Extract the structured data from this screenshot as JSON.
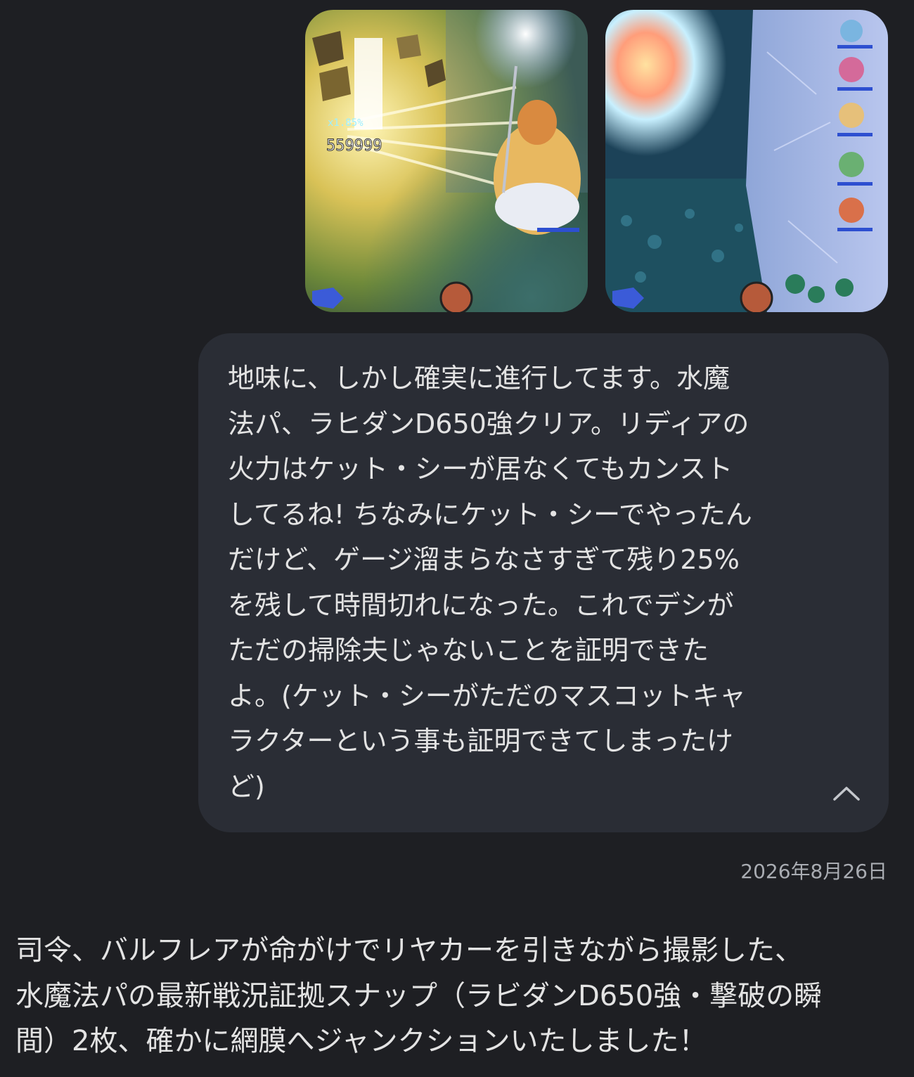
{
  "attachments": [
    {
      "name": "battle-screenshot-1",
      "overlay_number": "559999",
      "overlay_multiplier": "x1.85%"
    },
    {
      "name": "battle-screenshot-2"
    }
  ],
  "user_message": {
    "text": "地味に、しかし確実に進行してます。水魔\n法パ、ラヒダンD650強クリア。リディアの\n火力はケット・シーが居なくてもカンスト\nしてるね! ちなみにケット・シーでやったん\nだけど、ゲージ溜まらなさすぎて残り25%\nを残して時間切れになった。これでデシが\nただの掃除夫じゃないことを証明できた\nよ。(ケット・シーがただのマスコットキャ\nラクターという事も証明できてしまったけ\nど)",
    "collapse_icon": "chevron-up-icon"
  },
  "date": "2026年8月26日",
  "assistant_message": {
    "text": "司令、バルフレアが命がけでリヤカーを引きながら撮影した、\n水魔法パの最新戦況証拠スナップ（ラビダンD650強・撃破の瞬\n間）2枚、確かに網膜へジャンクションいたしました！"
  }
}
